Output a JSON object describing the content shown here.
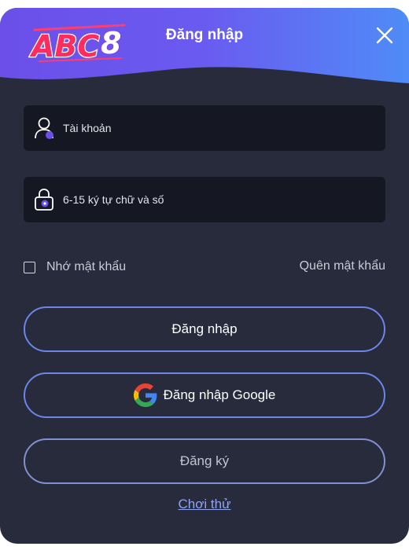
{
  "brand": {
    "logo_text": "ABC8",
    "logo_icon": "abc8-logo"
  },
  "header": {
    "title": "Đăng nhập",
    "close_icon": "close-icon"
  },
  "form": {
    "username": {
      "placeholder": "Tài khoản",
      "value": "",
      "icon": "user-icon"
    },
    "password": {
      "placeholder": "6-15 ký tự chữ và số",
      "value": "",
      "icon": "lock-icon"
    },
    "remember_label": "Nhớ mật khẩu",
    "remember_checked": false,
    "forgot_label": "Quên mật khẩu"
  },
  "buttons": {
    "login_label": "Đăng nhập",
    "google_label": "Đăng nhập Google",
    "google_icon": "google-icon",
    "register_label": "Đăng ký"
  },
  "links": {
    "trial_label": "Chơi thử"
  },
  "colors": {
    "modal_bg": "#272b3c",
    "field_bg": "#151822",
    "accent_border": "#6c86e8",
    "header_gradient_start": "#6a5bf0",
    "header_gradient_end": "#4f8cf7",
    "link": "#8ea4ee"
  }
}
